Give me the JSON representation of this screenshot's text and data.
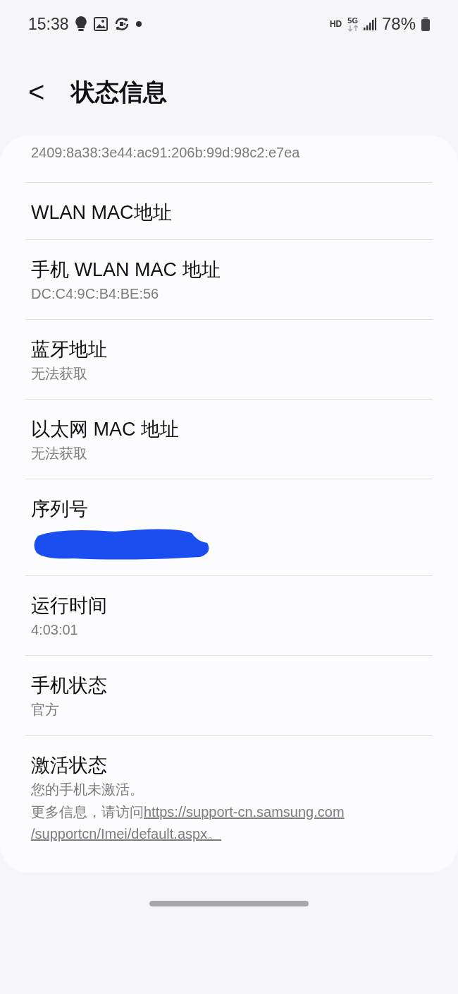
{
  "status_bar": {
    "time": "15:38",
    "network": "HD",
    "network_type": "5G",
    "battery": "78%"
  },
  "header": {
    "back": "<",
    "title": "状态信息"
  },
  "items": [
    {
      "kind": "partial",
      "value": "2409:8a38:3e44:ac91:206b:99d:98c2:e7ea"
    },
    {
      "kind": "plain",
      "title": "WLAN MAC地址"
    },
    {
      "kind": "plain",
      "title": "手机 WLAN MAC 地址",
      "value": "DC:C4:9C:B4:BE:56"
    },
    {
      "kind": "plain",
      "title": "蓝牙地址",
      "value": "无法获取"
    },
    {
      "kind": "plain",
      "title": "以太网 MAC 地址",
      "value": "无法获取"
    },
    {
      "kind": "plain",
      "title": "序列号",
      "redacted": true
    },
    {
      "kind": "plain",
      "title": "运行时间",
      "value": "4:03:01"
    },
    {
      "kind": "plain",
      "title": "手机状态",
      "value": "官方"
    },
    {
      "kind": "link",
      "title": "激活状态",
      "value": "您的手机未激活。",
      "note": "更多信息，请访问",
      "link_lines": [
        "https://support-cn.samsung.com",
        "/supportcn/Imei/default.aspx。"
      ]
    }
  ]
}
